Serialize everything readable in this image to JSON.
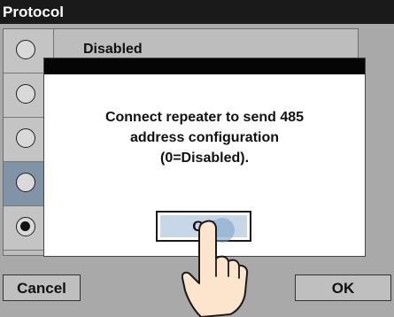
{
  "title": "Protocol",
  "list": {
    "rows": [
      {
        "label": "Disabled",
        "selected": false,
        "highlight": false
      },
      {
        "label": "",
        "selected": false,
        "highlight": false
      },
      {
        "label": "",
        "selected": false,
        "highlight": false
      },
      {
        "label": "",
        "selected": false,
        "highlight": true
      },
      {
        "label": "",
        "selected": true,
        "highlight": false
      }
    ]
  },
  "dialog": {
    "lines": [
      "Connect repeater to send 485",
      "address configuration",
      "(0=Disabled)."
    ],
    "ok_label": "OK"
  },
  "buttons": {
    "cancel": "Cancel",
    "ok": "OK"
  },
  "icons": {
    "touch": "pointing-hand-icon"
  }
}
